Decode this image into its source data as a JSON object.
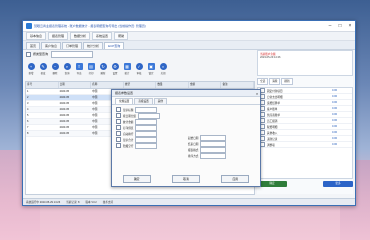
{
  "window": {
    "title": "慧眼云商业报表管理系统 - 账户数据统计 - 报表明细查询与导出 (当前操作员: 管理员)"
  },
  "menubar": [
    "基本信息",
    "报表管理",
    "数据分析",
    "系统设置",
    "帮助"
  ],
  "tabs": [
    "首页",
    "客户信息",
    "订单管理",
    "统计分析",
    "ECP查询"
  ],
  "search": {
    "label": "按类型查询",
    "placeholder": ""
  },
  "toolbar": [
    {
      "label": "新增",
      "icon": "plus-icon"
    },
    {
      "label": "修改",
      "icon": "edit-icon"
    },
    {
      "label": "删除",
      "icon": "trash-icon"
    },
    {
      "label": "查询",
      "icon": "search-icon"
    },
    {
      "label": "导出",
      "icon": "export-icon"
    },
    {
      "label": "打印",
      "icon": "print-icon"
    },
    {
      "label": "刷新",
      "icon": "refresh-icon"
    },
    {
      "label": "设置",
      "icon": "gear-icon"
    },
    {
      "label": "统计",
      "icon": "chart-icon"
    },
    {
      "label": "审核",
      "icon": "check-icon"
    },
    {
      "label": "锁定",
      "icon": "lock-icon"
    },
    {
      "label": "关闭",
      "icon": "close-icon"
    }
  ],
  "grid": {
    "headers": [
      "序号",
      "日期",
      "名称",
      "类型",
      "数量",
      "金额",
      "备注"
    ],
    "rows": [
      [
        "1",
        "2023-05",
        "中国",
        "标准",
        "12",
        "256.00",
        ""
      ],
      [
        "2",
        "2023-05",
        "中国",
        "标准",
        "8",
        "128.00",
        ""
      ],
      [
        "3",
        "2023-05",
        "中国",
        "加急",
        "5",
        "96.00",
        ""
      ],
      [
        "4",
        "2023-05",
        "中国",
        "标准",
        "20",
        "410.00",
        ""
      ],
      [
        "5",
        "2023-05",
        "中国",
        "标准",
        "3",
        "48.00",
        ""
      ],
      [
        "6",
        "2023-05",
        "中国",
        "加急",
        "7",
        "133.00",
        ""
      ],
      [
        "7",
        "2023-05",
        "中国",
        "标准",
        "11",
        "220.00",
        ""
      ],
      [
        "8",
        "2023-05",
        "中国",
        "标准",
        "9",
        "180.00",
        ""
      ]
    ]
  },
  "right_panel": {
    "header_line1": "当前账户余额",
    "header_line2": "2023-05-29 14:26",
    "tools": [
      "全选",
      "清除",
      "刷新"
    ],
    "items": [
      {
        "t": "固定付款项目",
        "v": "0.00"
      },
      {
        "t": "日常支出明细",
        "v": "0.00"
      },
      {
        "t": "运费结算单",
        "v": "0.00"
      },
      {
        "t": "客户账单",
        "v": "0.00"
      },
      {
        "t": "供应商账单",
        "v": "0.00"
      },
      {
        "t": "员工报销",
        "v": "0.00"
      },
      {
        "t": "税费明细",
        "v": "0.00"
      },
      {
        "t": "其他收入",
        "v": "0.00"
      },
      {
        "t": "退款记录",
        "v": "0.00"
      },
      {
        "t": "调整项",
        "v": "0.00"
      }
    ],
    "action_ok": "确定",
    "action_more": "更多"
  },
  "status": [
    "系统运行中 2023-05-29 14:26",
    "当前记录: 8",
    "版本 V3.2",
    "技术支持"
  ],
  "dialog": {
    "title": "报表参数设置",
    "tabs": [
      "常规设置",
      "高级设置",
      "其他"
    ],
    "options": [
      "显示标题",
      "按日期分组",
      "统计金额",
      "打印预览",
      "自动换行",
      "显示合计",
      "隐藏空行"
    ],
    "col2_options": [
      "起始日期",
      "结束日期",
      "报表格式",
      "排序方式"
    ],
    "buttons": [
      "确定",
      "取消",
      "应用"
    ]
  }
}
